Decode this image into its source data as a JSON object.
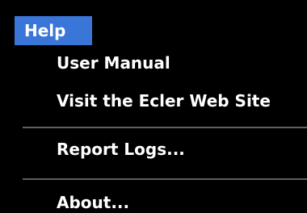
{
  "menubar": {
    "active_menu": "Help"
  },
  "menu": {
    "items": [
      {
        "label": "User Manual"
      },
      {
        "label": "Visit the Ecler Web Site"
      },
      {
        "label": "Report Logs..."
      },
      {
        "label": "About..."
      }
    ]
  },
  "colors": {
    "highlight": "#3a76d8",
    "background": "#000000",
    "text": "#ffffff",
    "separator": "#5f5f5f"
  }
}
